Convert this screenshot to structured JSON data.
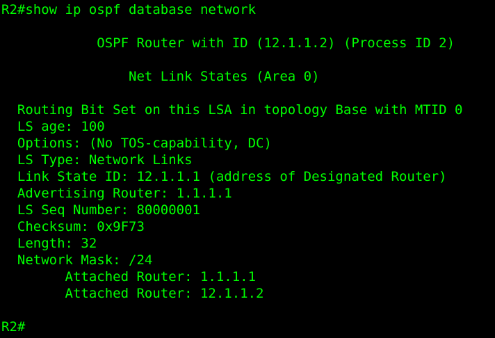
{
  "terminal": {
    "text_color": "#00ff00",
    "background_color": "#000000",
    "command_line": "R2#show ip ospf database network",
    "header": "            OSPF Router with ID (12.1.1.2) (Process ID 2)",
    "section_title": "                Net Link States (Area 0)",
    "lines": [
      "  Routing Bit Set on this LSA in topology Base with MTID 0",
      "  LS age: 100",
      "  Options: (No TOS-capability, DC)",
      "  LS Type: Network Links",
      "  Link State ID: 12.1.1.1 (address of Designated Router)",
      "  Advertising Router: 1.1.1.1",
      "  LS Seq Number: 80000001",
      "  Checksum: 0x9F73",
      "  Length: 32",
      "  Network Mask: /24",
      "        Attached Router: 1.1.1.1",
      "        Attached Router: 12.1.1.2"
    ],
    "prompt": "R2#"
  }
}
